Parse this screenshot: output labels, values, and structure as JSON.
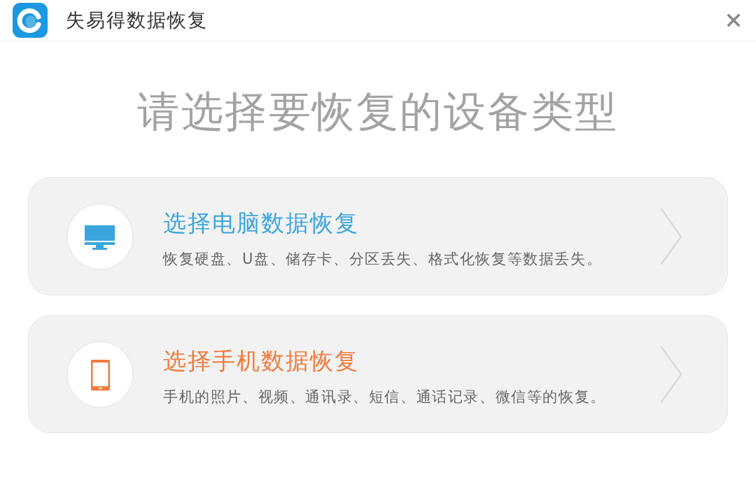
{
  "window": {
    "title": "失易得数据恢复"
  },
  "heading": "请选择要恢复的设备类型",
  "options": [
    {
      "kind": "computer",
      "title": "选择电脑数据恢复",
      "description": "恢复硬盘、U盘、储存卡、分区丢失、格式化恢复等数据丢失。",
      "color": "#3aa6dd"
    },
    {
      "kind": "phone",
      "title": "选择手机数据恢复",
      "description": "手机的照片、视频、通讯录、短信、通话记录、微信等的恢复。",
      "color": "#f07a3a"
    }
  ]
}
